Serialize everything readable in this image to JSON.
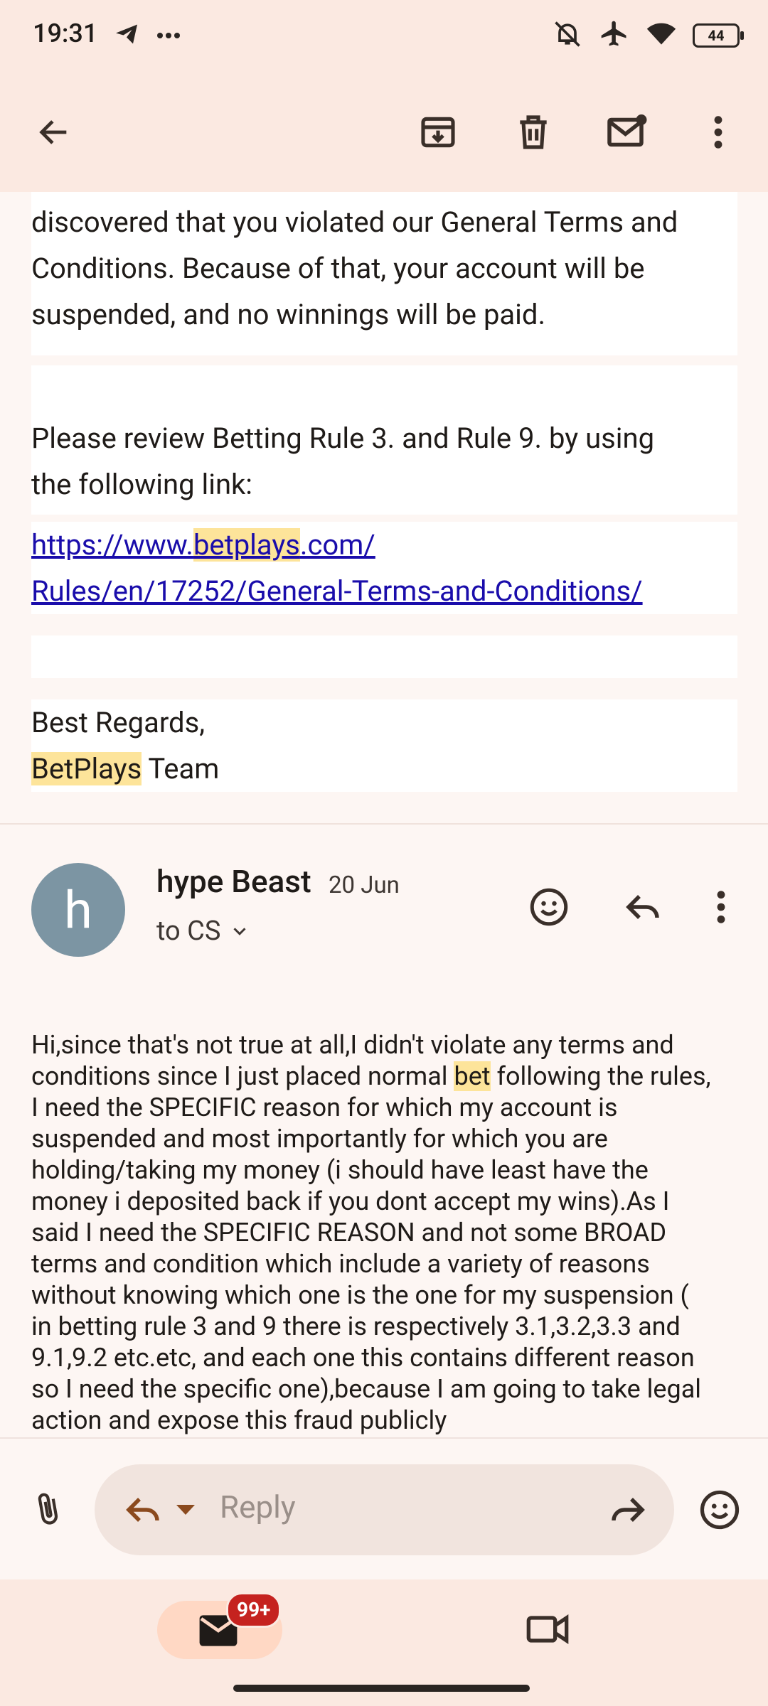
{
  "status_bar": {
    "time": "19:31",
    "battery": "44",
    "icons": [
      "telegram-icon",
      "more-dots-icon",
      "mute-icon",
      "airplane-icon",
      "wifi-icon",
      "battery-icon"
    ]
  },
  "toolbar": {
    "icons": [
      "back-arrow-icon",
      "archive-icon",
      "delete-icon",
      "mark-unread-icon",
      "more-vert-icon"
    ]
  },
  "quoted": {
    "para1_line1": "discovered that you violated our General Terms and",
    "para1_line2": "Conditions. Because of that, your account will be",
    "para1_line3": "suspended, and no winnings will be paid.",
    "para2_line1": "Please review Betting Rule 3. and Rule 9. by using",
    "para2_line2": "the following link:",
    "link_pre": "https://www.",
    "link_hl": "betplays",
    "link_post": ".com/",
    "link_line2": "Rules/en/17252/General-Terms-and-Conditions/",
    "regards": "Best Regards,",
    "team_hl": "BetPlays",
    "team_rest": " Team"
  },
  "message": {
    "avatar_letter": "h",
    "sender": "hype Beast",
    "date": "20 Jun",
    "recipient": "to CS",
    "body_lines": [
      {
        "pre": "Hi,since that's not true at all,I didn't violate any terms and",
        "hl": "",
        "post": ""
      },
      {
        "pre": "conditions since I just placed normal ",
        "hl": "bet",
        "post": " following the rules,"
      },
      {
        "pre": "I need the SPECIFIC reason for which my account is",
        "hl": "",
        "post": ""
      },
      {
        "pre": "suspended and most importantly for which you are",
        "hl": "",
        "post": ""
      },
      {
        "pre": "holding/taking my money (i should have least have the",
        "hl": "",
        "post": ""
      },
      {
        "pre": "money i deposited back if you dont accept my wins).As I",
        "hl": "",
        "post": ""
      },
      {
        "pre": "said I need the SPECIFIC REASON and not some BROAD",
        "hl": "",
        "post": ""
      },
      {
        "pre": "terms and condition which include a variety of reasons",
        "hl": "",
        "post": ""
      },
      {
        "pre": "without knowing which one is the one for my suspension (",
        "hl": "",
        "post": ""
      },
      {
        "pre": "in betting rule 3 and 9 there is respectively 3.1,3.2,3.3 and",
        "hl": "",
        "post": ""
      },
      {
        "pre": "9.1,9.2 etc.etc, and  each one this contains different reason",
        "hl": "",
        "post": ""
      },
      {
        "pre": "so I need the specific one),because I am going to take legal",
        "hl": "",
        "post": ""
      },
      {
        "pre": "action and expose this fraud publicly",
        "hl": "",
        "post": ""
      }
    ]
  },
  "reply": {
    "placeholder": "Reply"
  },
  "bottom_nav": {
    "mail_badge": "99+"
  },
  "colors": {
    "accent": "#8b4a1e",
    "link": "#1a0dab",
    "highlight": "#fde49a",
    "badge": "#c5221f"
  }
}
